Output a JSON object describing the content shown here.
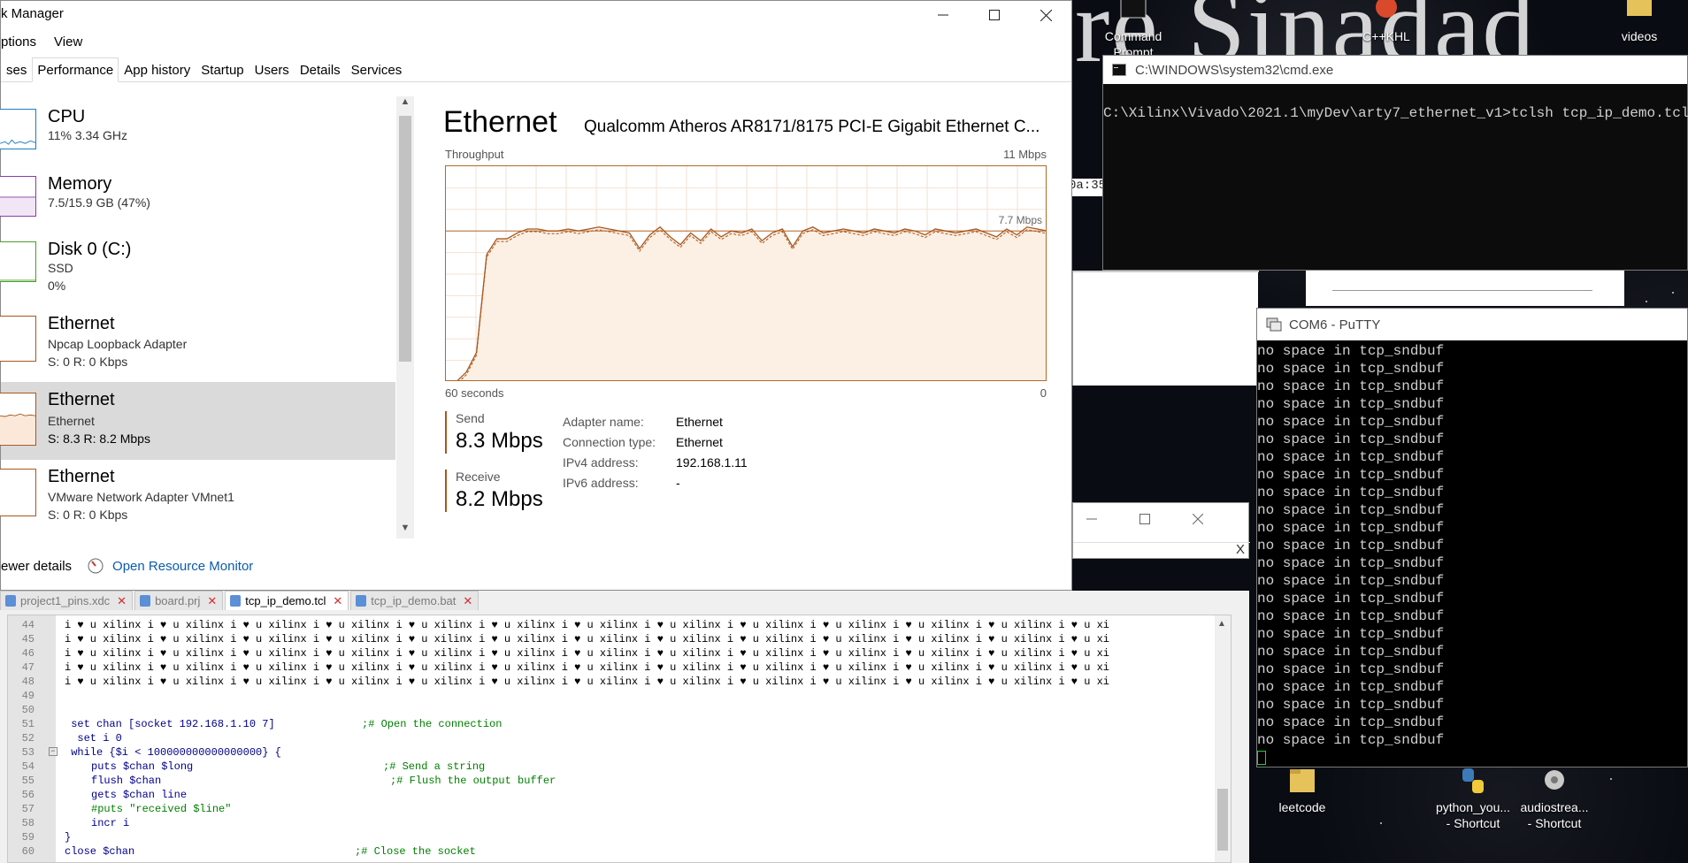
{
  "desktop": {
    "bg_text": "re Sinadad",
    "icons_top": [
      {
        "label": "Command",
        "sub": "Prompt",
        "icon": "command-prompt-icon"
      },
      {
        "label": "C++KHL",
        "sub": "",
        "icon": "cpp-icon"
      },
      {
        "label": "videos",
        "sub": "",
        "icon": "folder-icon"
      }
    ],
    "icons_bottom": [
      {
        "label": "leetcode",
        "sub": "",
        "icon": "folder-icon"
      },
      {
        "label": "python_you...",
        "sub": "- Shortcut",
        "icon": "python-icon"
      },
      {
        "label": "audiostrea...",
        "sub": "- Shortcut",
        "icon": "gear-icon"
      }
    ],
    "partial_text": "0a:35"
  },
  "taskmgr": {
    "title": "k Manager",
    "menu": [
      "ptions",
      "View"
    ],
    "tabs": [
      "ses",
      "Performance",
      "App history",
      "Startup",
      "Users",
      "Details",
      "Services"
    ],
    "active_tab": "Performance",
    "sidebar": [
      {
        "name": "CPU",
        "line1": "11%  3.34 GHz",
        "line2": "",
        "color": "#1d7fc2"
      },
      {
        "name": "Memory",
        "line1": "7.5/15.9 GB (47%)",
        "line2": "",
        "color": "#8a3ca6"
      },
      {
        "name": "Disk 0 (C:)",
        "line1": "SSD",
        "line2": "0%",
        "color": "#4d9e2b"
      },
      {
        "name": "Ethernet",
        "line1": "Npcap Loopback Adapter",
        "line2": "S: 0  R: 0 Kbps",
        "color": "#a8571b"
      },
      {
        "name": "Ethernet",
        "line1": "Ethernet",
        "line2": "S: 8.3  R: 8.2 Mbps",
        "color": "#a8571b"
      },
      {
        "name": "Ethernet",
        "line1": "VMware Network Adapter VMnet1",
        "line2": "S: 0  R: 0 Kbps",
        "color": "#a8571b"
      }
    ],
    "selected_index": 4,
    "main": {
      "title": "Ethernet",
      "adapter": "Qualcomm Atheros AR8171/8175 PCI-E Gigabit Ethernet C...",
      "graph_label": "Throughput",
      "graph_max": "11 Mbps",
      "graph_time": "60 seconds",
      "graph_zero": "0",
      "graph_marker": "7.7 Mbps",
      "send_label": "Send",
      "send_value": "8.3 Mbps",
      "receive_label": "Receive",
      "receive_value": "8.2 Mbps",
      "props": [
        {
          "k": "Adapter name:",
          "v": "Ethernet"
        },
        {
          "k": "Connection type:",
          "v": "Ethernet"
        },
        {
          "k": "IPv4 address:",
          "v": "192.168.1.11"
        },
        {
          "k": "IPv6 address:",
          "v": "-"
        }
      ]
    },
    "footer": {
      "fewer": "ewer details",
      "monitor": "Open Resource Monitor"
    }
  },
  "cmd": {
    "title": "C:\\WINDOWS\\system32\\cmd.exe",
    "line": "C:\\Xilinx\\Vivado\\2021.1\\myDev\\arty7_ethernet_v1>tclsh tcp_ip_demo.tcl"
  },
  "dialog": {
    "close": "X"
  },
  "putty": {
    "title": "COM6 - PuTTY",
    "lines": [
      "no space in tcp_sndbuf",
      "no space in tcp_sndbuf",
      "no space in tcp_sndbuf",
      "no space in tcp_sndbuf",
      "no space in tcp_sndbuf",
      "no space in tcp_sndbuf",
      "no space in tcp_sndbuf",
      "no space in tcp_sndbuf",
      "no space in tcp_sndbuf",
      "no space in tcp_sndbuf",
      "no space in tcp_sndbuf",
      "no space in tcp_sndbuf",
      "no space in tcp_sndbuf",
      "no space in tcp_sndbuf",
      "no space in tcp_sndbuf",
      "no space in tcp_sndbuf",
      "no space in tcp_sndbuf",
      "no space in tcp_sndbuf",
      "no space in tcp_sndbuf",
      "no space in tcp_sndbuf",
      "no space in tcp_sndbuf",
      "no space in tcp_sndbuf",
      "no space in tcp_sndbuf"
    ]
  },
  "editor": {
    "tabs": [
      {
        "label": "project1_pins.xdc",
        "active": false
      },
      {
        "label": "board.prj",
        "active": false
      },
      {
        "label": "tcp_ip_demo.tcl",
        "active": true
      },
      {
        "label": "tcp_ip_demo.bat",
        "active": false
      }
    ],
    "repeat_line": "i ♥ u xilinx i ♥ u xilinx i ♥ u xilinx i ♥ u xilinx i ♥ u xilinx i ♥ u xilinx i ♥ u xilinx i ♥ u xilinx i ♥ u xilinx i ♥ u xilinx i ♥ u xilinx i ♥ u xilinx i ♥ u xi",
    "line_numbers": [
      "44",
      "45",
      "46",
      "47",
      "48",
      "49",
      "50",
      "51",
      "52",
      "53",
      "54",
      "55",
      "56",
      "57",
      "58",
      "59",
      "60"
    ],
    "code": {
      "l51": " set chan [socket 192.168.1.10 7]",
      "l51_comment": ";# Open the connection",
      "l52": "  set i 0",
      "l53": " while {$i < 100000000000000000} {",
      "l54": "puts $chan $long",
      "l54_comment": ";# Send a string",
      "l55": "flush $chan",
      "l55_comment": ";# Flush the output buffer",
      "l56": "gets $chan line",
      "l57": "#puts \"received $line\"",
      "l58": "incr i",
      "l59": "}",
      "l60": "close $chan",
      "l60_comment": ";# Close the socket"
    }
  }
}
